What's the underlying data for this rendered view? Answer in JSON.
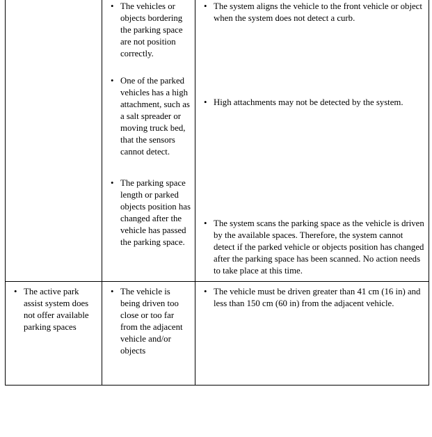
{
  "document": {
    "type": "troubleshooting-table",
    "bullet_glyph": "•",
    "columns": 3
  },
  "table": {
    "rows": [
      {
        "id": "row-1",
        "cause_cell": {
          "items": []
        },
        "detail_cell": {
          "items": [
            "The vehicles or objects bordering the parking space are not position correctly.",
            "One of the parked vehicles has a high attachment, such as a salt spreader or moving truck bed, that the sensors cannot detect.",
            "The parking space length or parked objects position has changed after the vehicle has passed the parking space."
          ]
        },
        "action_cell": {
          "items": [
            "The system aligns the vehicle to the front vehicle or object when the system does not detect a curb.",
            "High attachments may not be detected by the system.",
            "The system scans the parking space as the vehicle is driven by the available spaces. Therefore, the system cannot detect if the parked vehicle or objects position has changed after the parking space has been scanned. No action needs to take place at this time."
          ]
        }
      },
      {
        "id": "row-2",
        "cause_cell": {
          "items": [
            "The active park assist system does not offer available parking spaces"
          ]
        },
        "detail_cell": {
          "items": [
            "The vehicle is being driven too close or too far from the adjacent vehicle and/or objects"
          ]
        },
        "action_cell": {
          "items": [
            "The vehicle must be driven greater than 41 cm (16 in) and less than 150 cm (60 in) from the adjacent vehicle."
          ]
        }
      }
    ]
  }
}
